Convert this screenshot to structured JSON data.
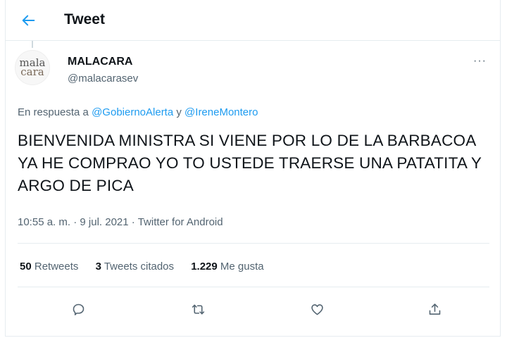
{
  "header": {
    "title": "Tweet"
  },
  "author": {
    "name": "MALACARA",
    "handle": "@malacarasev",
    "avatar_text_1": "mala",
    "avatar_text_2": "cara"
  },
  "reply": {
    "prefix": "En respuesta a",
    "user1": "@GobiernoAlerta",
    "connector": "y",
    "user2": "@IreneMontero"
  },
  "tweet": {
    "text": "BIENVENIDA MINISTRA SI VIENE POR LO DE LA BARBACOA YA HE COMPRAO YO TO USTEDE TRAERSE UNA PATATITA Y ARGO DE PICA",
    "time": "10:55 a. m.",
    "separator": "·",
    "date": "9 jul. 2021",
    "source": "Twitter for Android"
  },
  "stats": {
    "retweets_count": "50",
    "retweets_label": "Retweets",
    "quotes_count": "3",
    "quotes_label": "Tweets citados",
    "likes_count": "1.229",
    "likes_label": "Me gusta"
  },
  "menu": {
    "more": "···"
  },
  "colors": {
    "accent": "#1d9bf0",
    "secondary_text": "#536471",
    "border": "#e6ecf0"
  },
  "icons": {
    "back": "arrow-left-icon",
    "reply": "comment-icon",
    "retweet": "retweet-icon",
    "like": "heart-icon",
    "share": "share-icon"
  }
}
